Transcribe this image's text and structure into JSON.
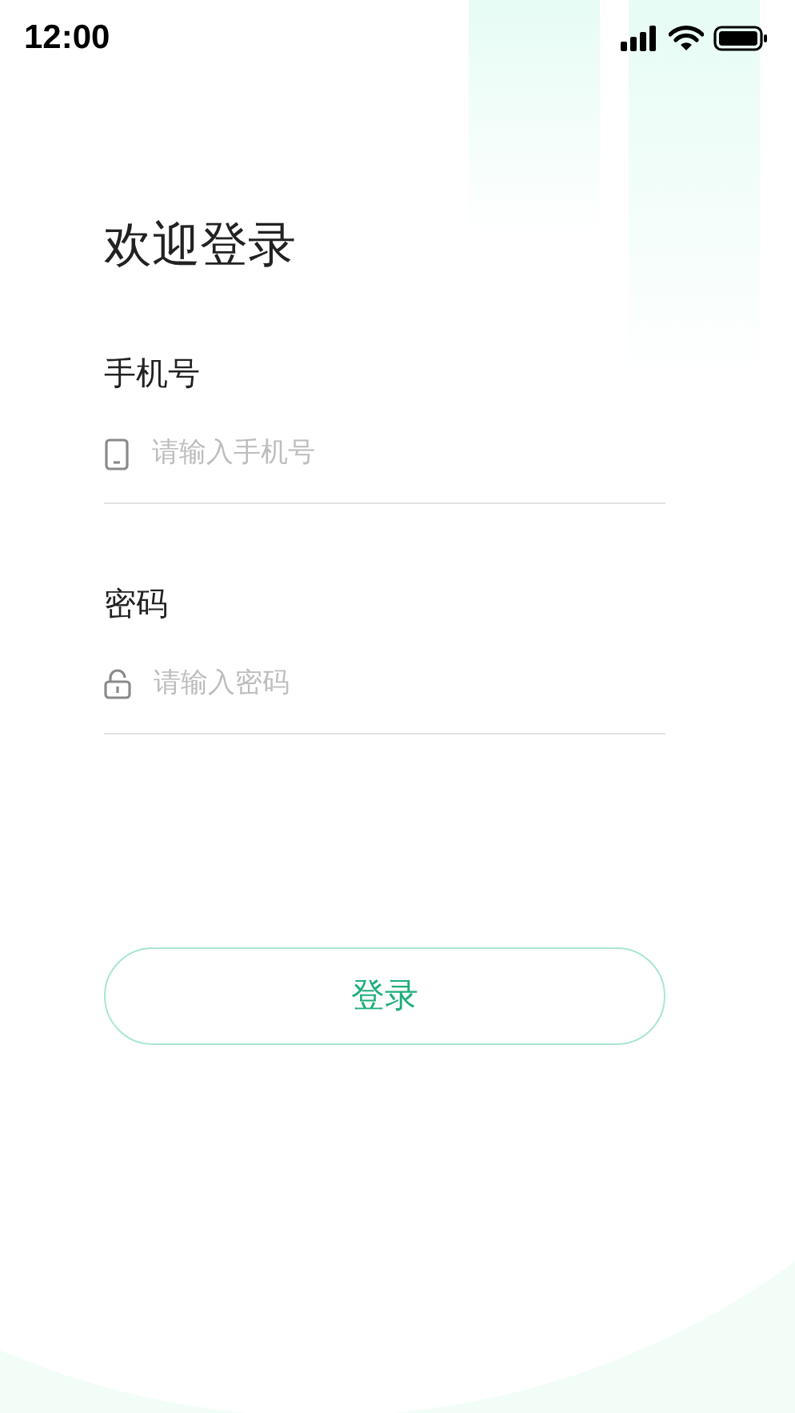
{
  "status_bar": {
    "time": "12:00"
  },
  "title": "欢迎登录",
  "fields": [
    {
      "kind": "phone",
      "label": "手机号",
      "placeholder": "请输入手机号"
    },
    {
      "kind": "password",
      "label": "密码",
      "placeholder": "请输入密码"
    }
  ],
  "login_button": "登录"
}
